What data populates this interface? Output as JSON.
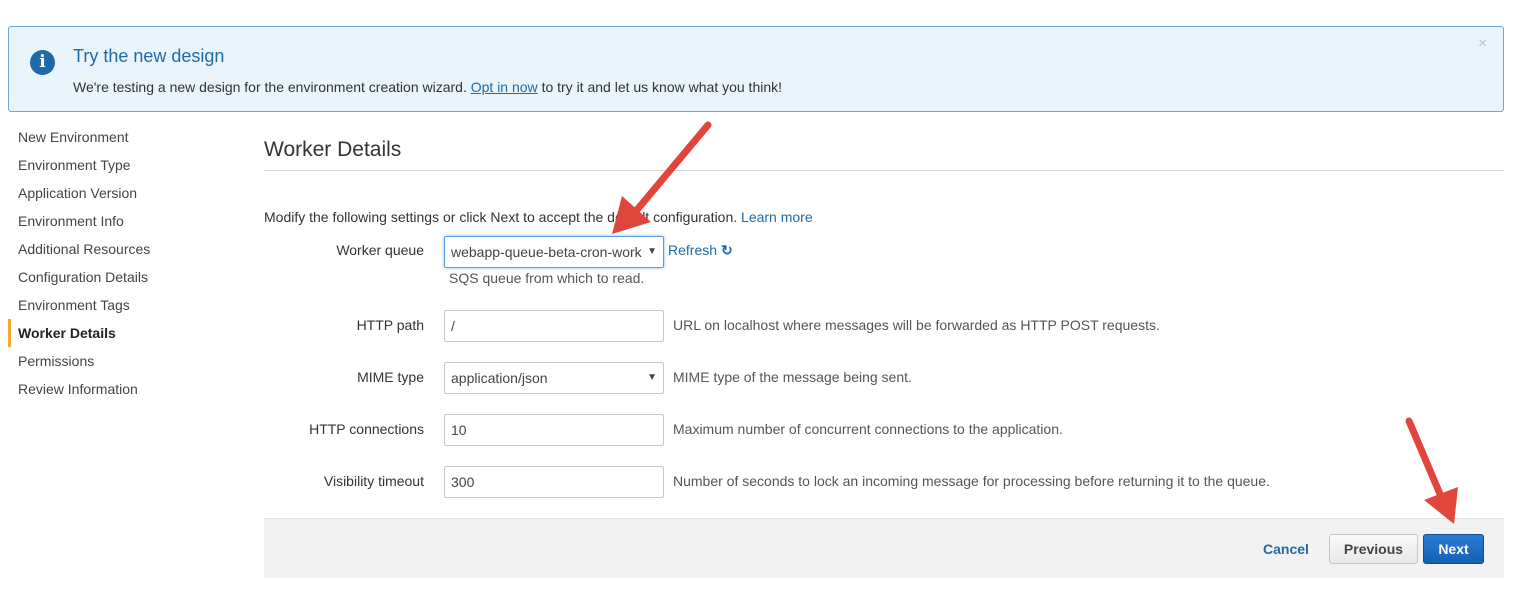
{
  "banner": {
    "title": "Try the new design",
    "text_before": "We're testing a new design for the environment creation wizard.",
    "link": "Opt in now",
    "text_after": "to try it and let us know what you think!",
    "close": "×"
  },
  "sidebar": {
    "items": [
      {
        "label": "New Environment"
      },
      {
        "label": "Environment Type"
      },
      {
        "label": "Application Version"
      },
      {
        "label": "Environment Info"
      },
      {
        "label": "Additional Resources"
      },
      {
        "label": "Configuration Details"
      },
      {
        "label": "Environment Tags"
      },
      {
        "label": "Worker Details"
      },
      {
        "label": "Permissions"
      },
      {
        "label": "Review Information"
      }
    ],
    "active_index": 7,
    "accent_color": "#f0a92e"
  },
  "page": {
    "title": "Worker Details",
    "intro": "Modify the following settings or click Next to accept the default configuration.",
    "learn_more": "Learn more"
  },
  "form": {
    "worker_queue": {
      "label": "Worker queue",
      "value": "webapp-queue-beta-cron-work",
      "help": "SQS queue from which to read.",
      "refresh": "Refresh"
    },
    "http_path": {
      "label": "HTTP path",
      "value": "/",
      "help": "URL on localhost where messages will be forwarded as HTTP POST requests."
    },
    "mime_type": {
      "label": "MIME type",
      "value": "application/json",
      "help": "MIME type of the message being sent."
    },
    "http_connections": {
      "label": "HTTP connections",
      "value": "10",
      "help": "Maximum number of concurrent connections to the application."
    },
    "visibility_timeout": {
      "label": "Visibility timeout",
      "value": "300",
      "help": "Number of seconds to lock an incoming message for processing before returning it to the queue."
    }
  },
  "footer": {
    "cancel": "Cancel",
    "previous": "Previous",
    "next": "Next"
  },
  "colors": {
    "link": "#1e6aa8",
    "primary_button": "#1660b7",
    "annotation_arrow": "#e0463c"
  }
}
